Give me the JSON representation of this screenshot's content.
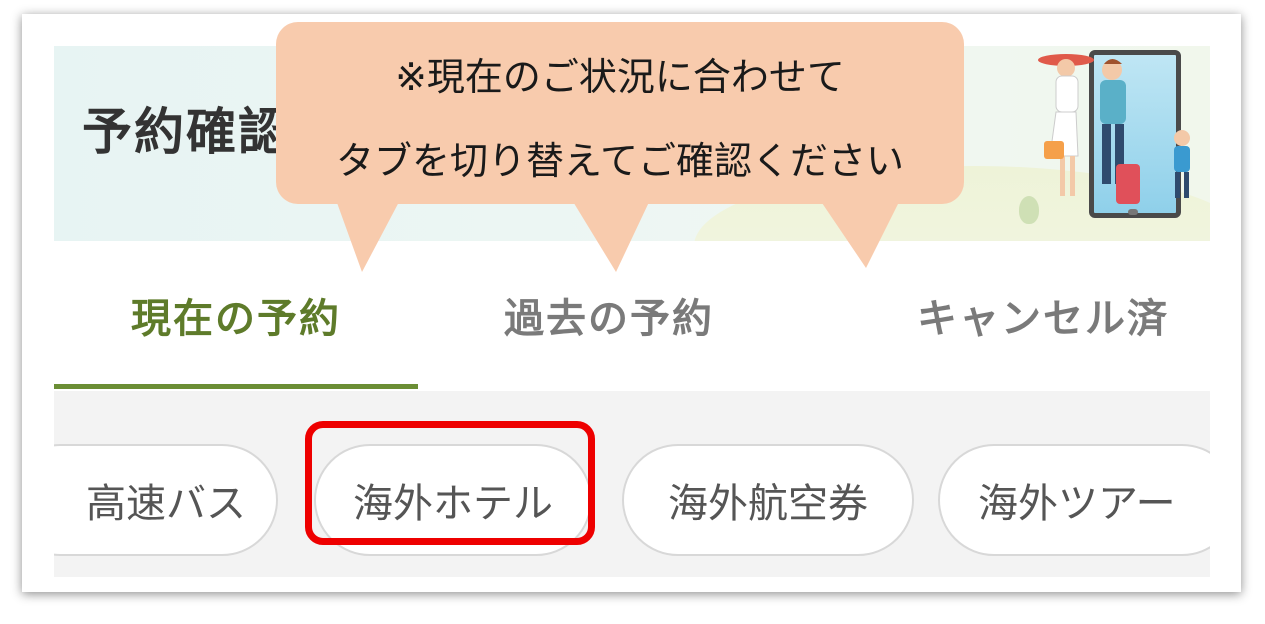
{
  "header": {
    "title": "予約確認"
  },
  "callout": {
    "line1": "※現在のご状況に合わせて",
    "line2": "タブを切り替えてご確認ください",
    "color": "#f8cbad"
  },
  "tabs": [
    {
      "label": "現在の予約",
      "active": true
    },
    {
      "label": "過去の予約",
      "active": false
    },
    {
      "label": "キャンセル済",
      "active": false
    }
  ],
  "categories": [
    {
      "label": "高速バス",
      "selected": false
    },
    {
      "label": "海外ホテル",
      "selected": true
    },
    {
      "label": "海外航空券",
      "selected": false
    },
    {
      "label": "海外ツアー",
      "selected": false
    }
  ],
  "colors": {
    "active_tab": "#5e7b2a",
    "highlight": "#ee0000",
    "banner_bg": "#e7f4f3"
  }
}
